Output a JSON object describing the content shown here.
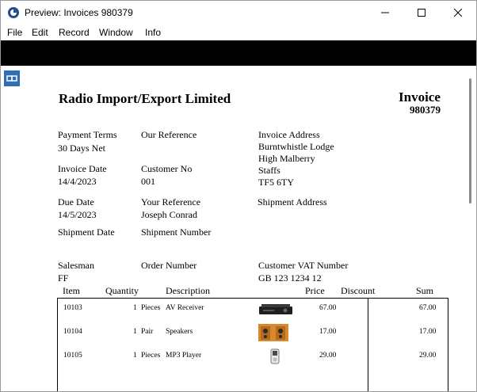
{
  "window": {
    "title": "Preview: Invoices 980379"
  },
  "menu": [
    "File",
    "Edit",
    "Record",
    "Window",
    "Info"
  ],
  "invoice": {
    "company": "Radio Import/Export Limited",
    "heading": "Invoice",
    "number": "980379",
    "fields": {
      "payment_terms_label": "Payment Terms",
      "payment_terms": "30 Days Net",
      "our_reference_label": "Our Reference",
      "invoice_address_label": "Invoice Address",
      "address_lines": [
        "Burntwhistle Lodge",
        "High Malberry",
        "Staffs",
        "TF5 6TY"
      ],
      "invoice_date_label": "Invoice Date",
      "invoice_date": "14/4/2023",
      "customer_no_label": "Customer No",
      "customer_no": "001",
      "due_date_label": "Due Date",
      "due_date": "14/5/2023",
      "your_reference_label": "Your Reference",
      "your_reference": "Joseph Conrad",
      "shipment_address_label": "Shipment Address",
      "shipment_date_label": "Shipment Date",
      "shipment_number_label": "Shipment Number",
      "salesman_label": "Salesman",
      "salesman": "FF",
      "order_number_label": "Order Number",
      "vat_label": "Customer VAT Number",
      "vat": "GB 123 1234 12"
    },
    "columns": {
      "item": "Item",
      "quantity": "Quantity",
      "description": "Description",
      "price": "Price",
      "discount": "Discount",
      "sum": "Sum"
    },
    "rows": [
      {
        "item": "10103",
        "qty": "1",
        "unit": "Pieces",
        "description": "AV Receiver",
        "price": "67.00",
        "sum": "67.00",
        "thumb": "av-receiver"
      },
      {
        "item": "10104",
        "qty": "1",
        "unit": "Pair",
        "description": "Speakers",
        "price": "17.00",
        "sum": "17.00",
        "thumb": "speakers"
      },
      {
        "item": "10105",
        "qty": "1",
        "unit": "Pieces",
        "description": "MP3 Player",
        "price": "29.00",
        "sum": "29.00",
        "thumb": "mp3-player"
      }
    ]
  },
  "colors": {
    "accent": "#2c6fb7",
    "toolbar": "#000000",
    "frame": "#9a9a9a"
  }
}
